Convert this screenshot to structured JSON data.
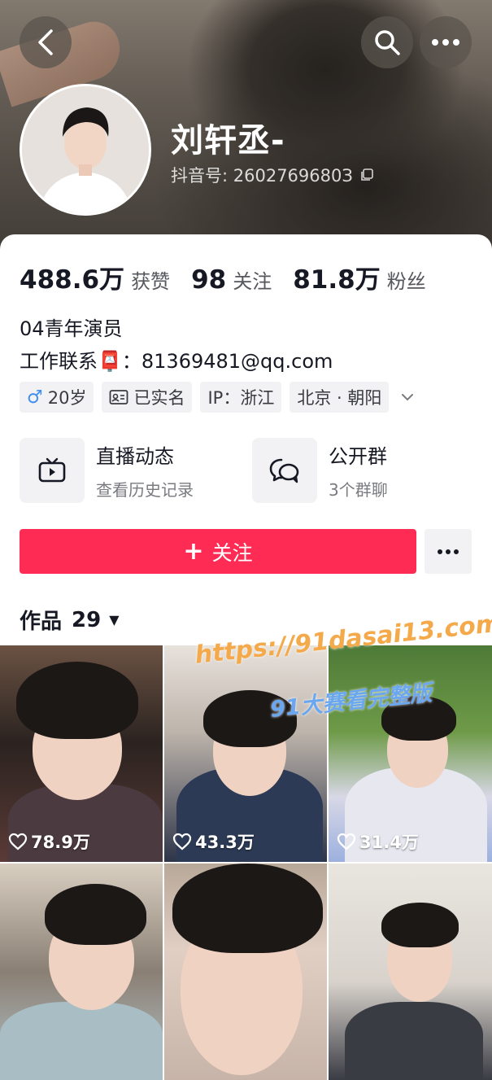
{
  "header": {
    "nickname": "刘轩丞-",
    "douyin_id": "抖音号: 2602769680З"
  },
  "stats": [
    {
      "value": "488.6万",
      "label": "获赞"
    },
    {
      "value": "98",
      "label": "关注"
    },
    {
      "value": "81.8万",
      "label": "粉丝"
    }
  ],
  "bio": {
    "line1": "04青年演员",
    "line2_prefix": "工作联系",
    "line2_icon": "📮",
    "line2_contact": "：81369481@qq.com"
  },
  "tags": [
    {
      "icon": "male-icon",
      "label": "20岁"
    },
    {
      "icon": "id-card-icon",
      "label": "已实名"
    },
    {
      "icon": "",
      "label": "IP：浙江"
    },
    {
      "icon": "",
      "label": "北京 · 朝阳"
    }
  ],
  "features": {
    "live": {
      "title": "直播动态",
      "sub": "查看历史记录",
      "icon": "tv-icon"
    },
    "group": {
      "title": "公开群",
      "sub": "3个群聊",
      "icon": "chat-icon"
    }
  },
  "follow": {
    "label": "关注",
    "plus": "+"
  },
  "works": {
    "label": "作品",
    "count": "29"
  },
  "videos": [
    {
      "likes": "78.9万"
    },
    {
      "likes": "43.3万"
    },
    {
      "likes": "31.4万"
    },
    {
      "likes": ""
    },
    {
      "likes": ""
    },
    {
      "likes": ""
    }
  ],
  "watermark": {
    "url": "https://91dasai13.com",
    "text": "91大赛看完整版"
  },
  "colors": {
    "accent": "#fe2c55",
    "male": "#3f8ff0"
  }
}
